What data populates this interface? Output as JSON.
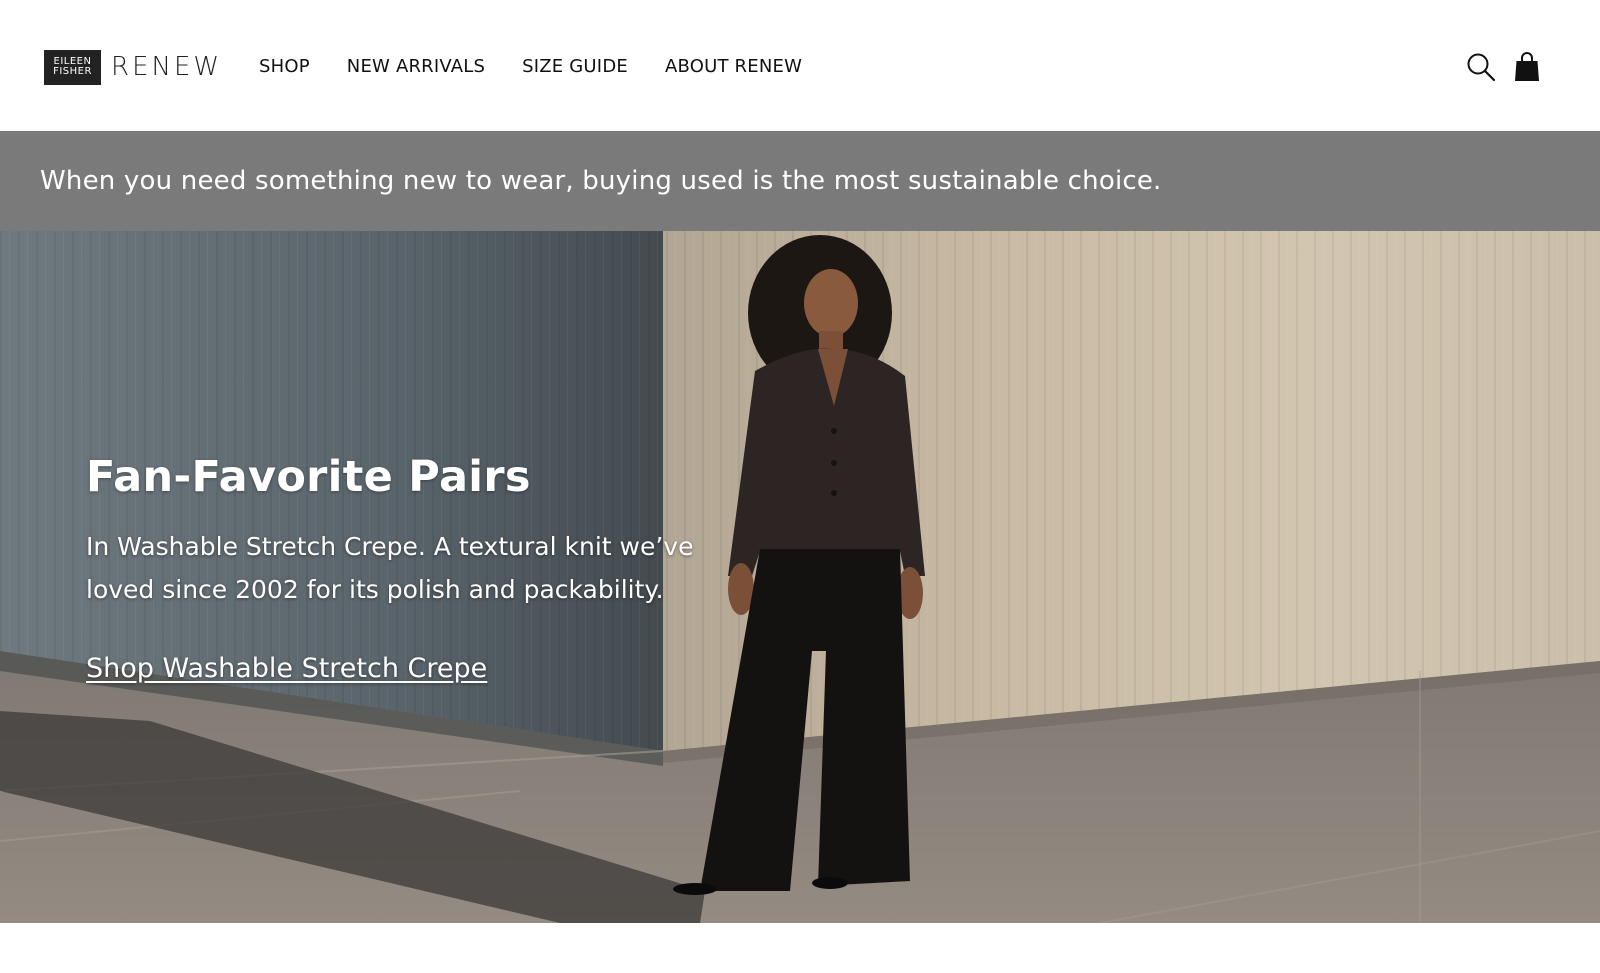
{
  "brand": {
    "logo_line1": "EILEEN",
    "logo_line2": "FISHER",
    "logo_word": "RENEW"
  },
  "nav": {
    "items": [
      {
        "label": "SHOP"
      },
      {
        "label": "NEW ARRIVALS"
      },
      {
        "label": "SIZE GUIDE"
      },
      {
        "label": "ABOUT RENEW"
      }
    ]
  },
  "header_icons": {
    "search": "search-icon",
    "bag": "shopping-bag-icon"
  },
  "announcement": {
    "text": "When you need something new to wear, buying used is the most sustainable choice."
  },
  "hero": {
    "title": "Fan-Favorite Pairs",
    "description": "In Washable Stretch Crepe. A textural knit we’ve loved since 2002 for its polish and packability.",
    "link_label": "Shop Washable Stretch Crepe"
  },
  "colors": {
    "announcement_bg": "#7a7a7a",
    "logo_box": "#222222",
    "text": "#111111"
  }
}
